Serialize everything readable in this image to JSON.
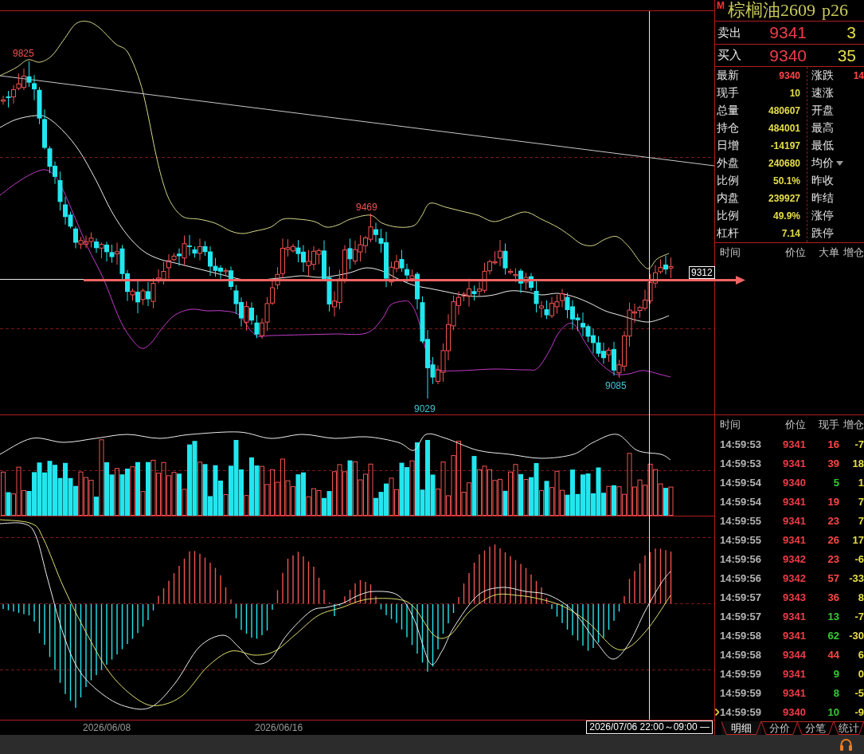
{
  "chart": {
    "price_labels": [
      {
        "text": "9825",
        "kind": "high"
      },
      {
        "text": "9469",
        "kind": "high"
      },
      {
        "text": "9029",
        "kind": "low"
      },
      {
        "text": "9085",
        "kind": "low"
      }
    ],
    "price_tag": "9312",
    "dates": [
      "2026/06/08",
      "2026/06/16"
    ],
    "cursor_time": "2026/07/06 22:00～09:00 —"
  },
  "quote": {
    "badge": "M",
    "name": "棕榈油2609",
    "code": "p26",
    "ask": {
      "label": "卖出",
      "price": "9341",
      "volume": "3"
    },
    "bid": {
      "label": "买入",
      "price": "9340",
      "volume": "35"
    },
    "stats": [
      {
        "label": "最新",
        "value": "9340",
        "color": "#ff4646"
      },
      {
        "label": "现手",
        "value": "10",
        "color": "#e6de4a"
      },
      {
        "label": "总量",
        "value": "480607",
        "color": "#e6de4a"
      },
      {
        "label": "持仓",
        "value": "484001",
        "color": "#e6de4a"
      },
      {
        "label": "日增",
        "value": "-14197",
        "color": "#e6de4a"
      },
      {
        "label": "外盘",
        "value": "240680",
        "color": "#e6de4a"
      },
      {
        "label": "比例",
        "value": "50.1%",
        "color": "#e6de4a"
      },
      {
        "label": "内盘",
        "value": "239927",
        "color": "#e6de4a"
      },
      {
        "label": "比例",
        "value": "49.9%",
        "color": "#e6de4a"
      },
      {
        "label": "杠杆",
        "value": "7.14",
        "color": "#e6de4a"
      }
    ],
    "stats_right": [
      {
        "label": "涨跌",
        "value": "14",
        "color": "#ff4646",
        "dropdown": false
      },
      {
        "label": "速涨",
        "dropdown": false
      },
      {
        "label": "开盘",
        "dropdown": false
      },
      {
        "label": "最高",
        "dropdown": false
      },
      {
        "label": "最低",
        "dropdown": false
      },
      {
        "label": "均价",
        "dropdown": true
      },
      {
        "label": "昨收",
        "dropdown": false
      },
      {
        "label": "昨结",
        "dropdown": false
      },
      {
        "label": "涨停",
        "dropdown": false
      },
      {
        "label": "跌停",
        "dropdown": false
      }
    ]
  },
  "big_orders": {
    "columns": [
      "时间",
      "价位",
      "大单",
      "增仓"
    ]
  },
  "trades": {
    "columns": [
      "时间",
      "价位",
      "现手",
      "增仓"
    ],
    "rows": [
      {
        "time": "14:59:53",
        "price": "9341",
        "volume": "16",
        "change": "-7",
        "color": "#ff4646",
        "latest": false
      },
      {
        "time": "14:59:53",
        "price": "9341",
        "volume": "39",
        "change": "18",
        "color": "#ff4646",
        "latest": false
      },
      {
        "time": "14:59:54",
        "price": "9340",
        "volume": "5",
        "change": "1",
        "color": "#33cc33",
        "latest": false
      },
      {
        "time": "14:59:54",
        "price": "9341",
        "volume": "19",
        "change": "7",
        "color": "#ff4646",
        "latest": false
      },
      {
        "time": "14:59:55",
        "price": "9341",
        "volume": "23",
        "change": "7",
        "color": "#ff4646",
        "latest": false
      },
      {
        "time": "14:59:55",
        "price": "9341",
        "volume": "26",
        "change": "17",
        "color": "#ff4646",
        "latest": false
      },
      {
        "time": "14:59:56",
        "price": "9342",
        "volume": "23",
        "change": "-6",
        "color": "#ff4646",
        "latest": false
      },
      {
        "time": "14:59:56",
        "price": "9342",
        "volume": "57",
        "change": "-33",
        "color": "#ff4646",
        "latest": false
      },
      {
        "time": "14:59:57",
        "price": "9343",
        "volume": "36",
        "change": "8",
        "color": "#ff4646",
        "latest": false
      },
      {
        "time": "14:59:57",
        "price": "9341",
        "volume": "13",
        "change": "-7",
        "color": "#33cc33",
        "latest": false
      },
      {
        "time": "14:59:58",
        "price": "9341",
        "volume": "62",
        "change": "-30",
        "color": "#33cc33",
        "latest": false
      },
      {
        "time": "14:59:58",
        "price": "9344",
        "volume": "44",
        "change": "6",
        "color": "#ff4646",
        "latest": false
      },
      {
        "time": "14:59:59",
        "price": "9341",
        "volume": "9",
        "change": "0",
        "color": "#33cc33",
        "latest": false
      },
      {
        "time": "14:59:59",
        "price": "9341",
        "volume": "8",
        "change": "-5",
        "color": "#33cc33",
        "latest": false
      },
      {
        "time": "14:59:59",
        "price": "9340",
        "volume": "10",
        "change": "-9",
        "color": "#33cc33",
        "latest": true
      }
    ]
  },
  "tabs": [
    {
      "label": "明细",
      "selected": true
    },
    {
      "label": "分价",
      "selected": false
    },
    {
      "label": "分笔",
      "selected": false
    },
    {
      "label": "统计",
      "selected": false
    }
  ]
}
